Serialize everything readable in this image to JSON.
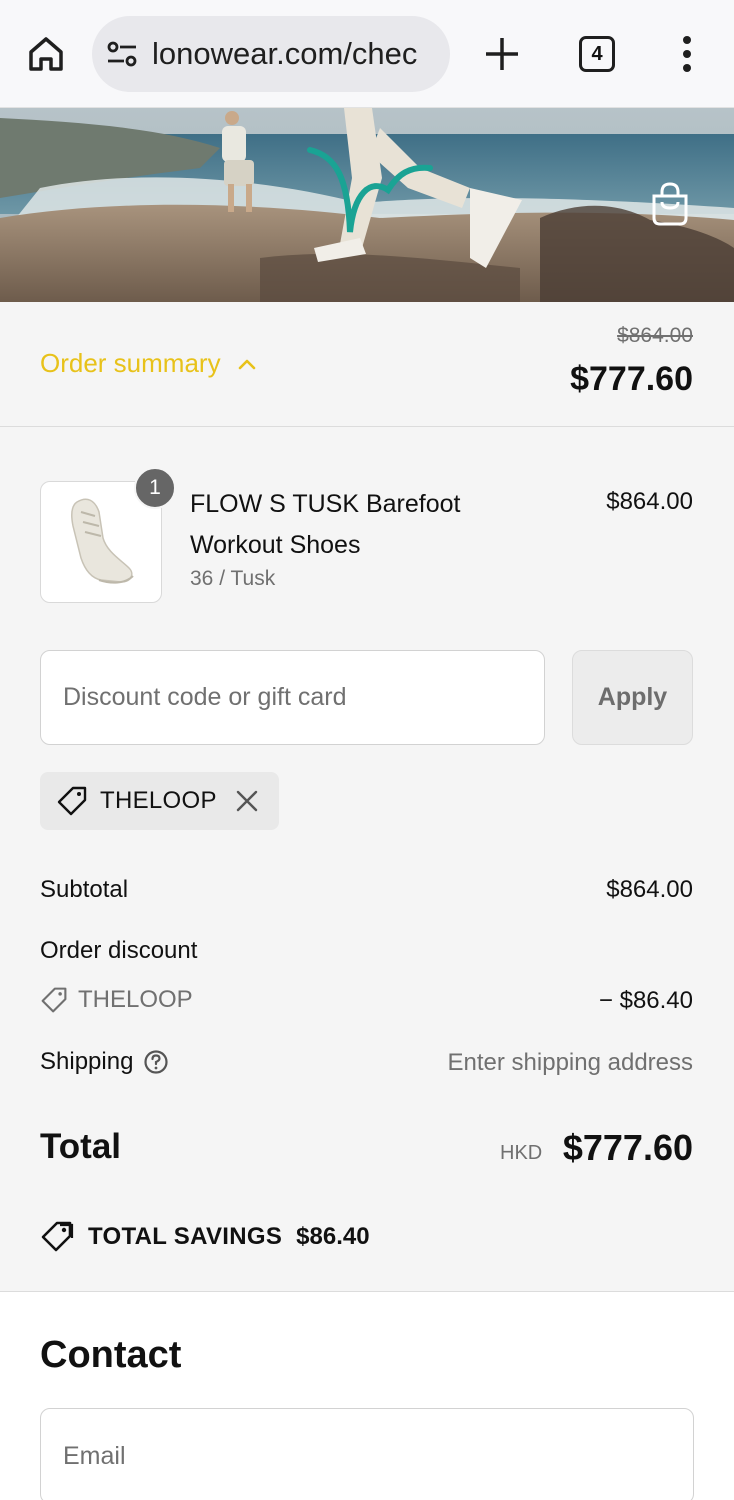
{
  "browser": {
    "url": "lonowear.com/chec",
    "tab_count": "4",
    "icons": [
      "home-icon",
      "site-settings-icon",
      "new-tab-icon",
      "tab-switcher-icon",
      "menu-icon"
    ]
  },
  "header": {
    "cart_icon": "shopping-bag-icon"
  },
  "summary": {
    "toggle_label": "Order summary",
    "original_total": "$864.00",
    "discounted_total": "$777.60",
    "accent_color": "#e8c21a"
  },
  "product": {
    "quantity": "1",
    "name": "FLOW S TUSK Barefoot Workout Shoes",
    "variant": "36 / Tusk",
    "price": "$864.00"
  },
  "discount": {
    "placeholder": "Discount code or gift card",
    "apply_label": "Apply",
    "applied_code": "THELOOP"
  },
  "totals": {
    "subtotal_label": "Subtotal",
    "subtotal_value": "$864.00",
    "order_discount_label": "Order discount",
    "discount_code": "THELOOP",
    "discount_value": "− $86.40",
    "shipping_label": "Shipping",
    "shipping_value": "Enter shipping address",
    "total_label": "Total",
    "currency": "HKD",
    "total_value": "$777.60",
    "savings_label": "TOTAL SAVINGS",
    "savings_value": "$86.40"
  },
  "contact": {
    "title": "Contact",
    "email_placeholder": "Email"
  }
}
